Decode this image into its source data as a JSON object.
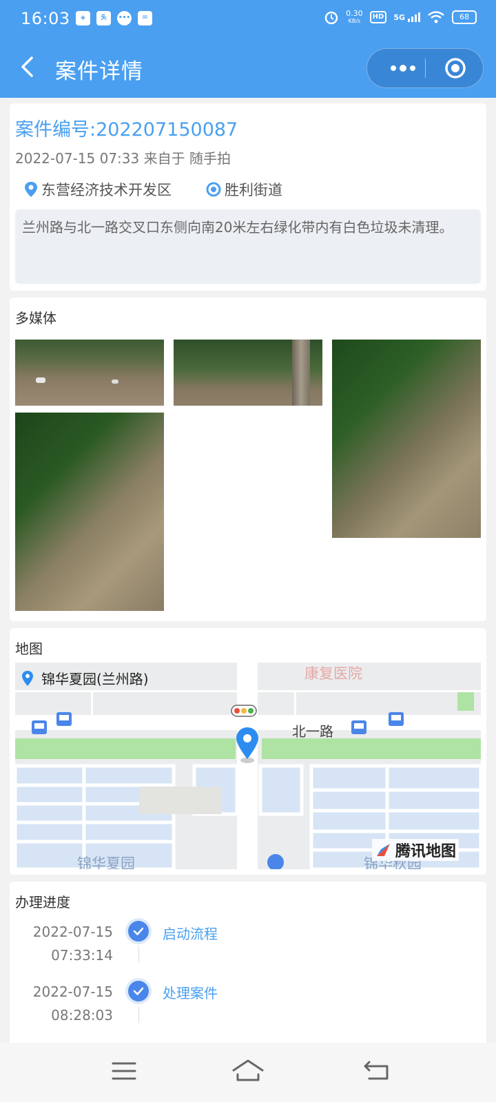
{
  "status_bar": {
    "time": "16:03",
    "net_speed_value": "0.30",
    "net_speed_unit": "KB/s",
    "hd_label": "HD",
    "network_label": "5G",
    "battery": "68"
  },
  "nav": {
    "title": "案件详情"
  },
  "case": {
    "number": "案件编号:202207150087",
    "datetime": "2022-07-15 07:33",
    "source_prefix": "来自于",
    "source": "随手拍",
    "district": "东营经济技术开发区",
    "street": "胜利街道",
    "description": "兰州路与北一路交叉口东侧向南20米左右绿化带内有白色垃圾未清理。"
  },
  "media": {
    "title": "多媒体",
    "photo_count": 4
  },
  "map": {
    "title": "地图",
    "location_name": "锦华夏园(兰州路)",
    "labels": {
      "hospital": "康复医院",
      "road": "北一路",
      "bottom_left": "锦华夏园",
      "bottom_right": "锦华秋园",
      "logo": "腾讯地图"
    }
  },
  "progress": {
    "title": "办理进度",
    "steps": [
      {
        "date": "2022-07-15",
        "time": "07:33:14",
        "label": "启动流程"
      },
      {
        "date": "2022-07-15",
        "time": "08:28:03",
        "label": "处理案件"
      }
    ]
  },
  "colors": {
    "accent": "#4a9ff0",
    "header": "#4a9ff0",
    "timeline_dot": "#4a86ea"
  }
}
